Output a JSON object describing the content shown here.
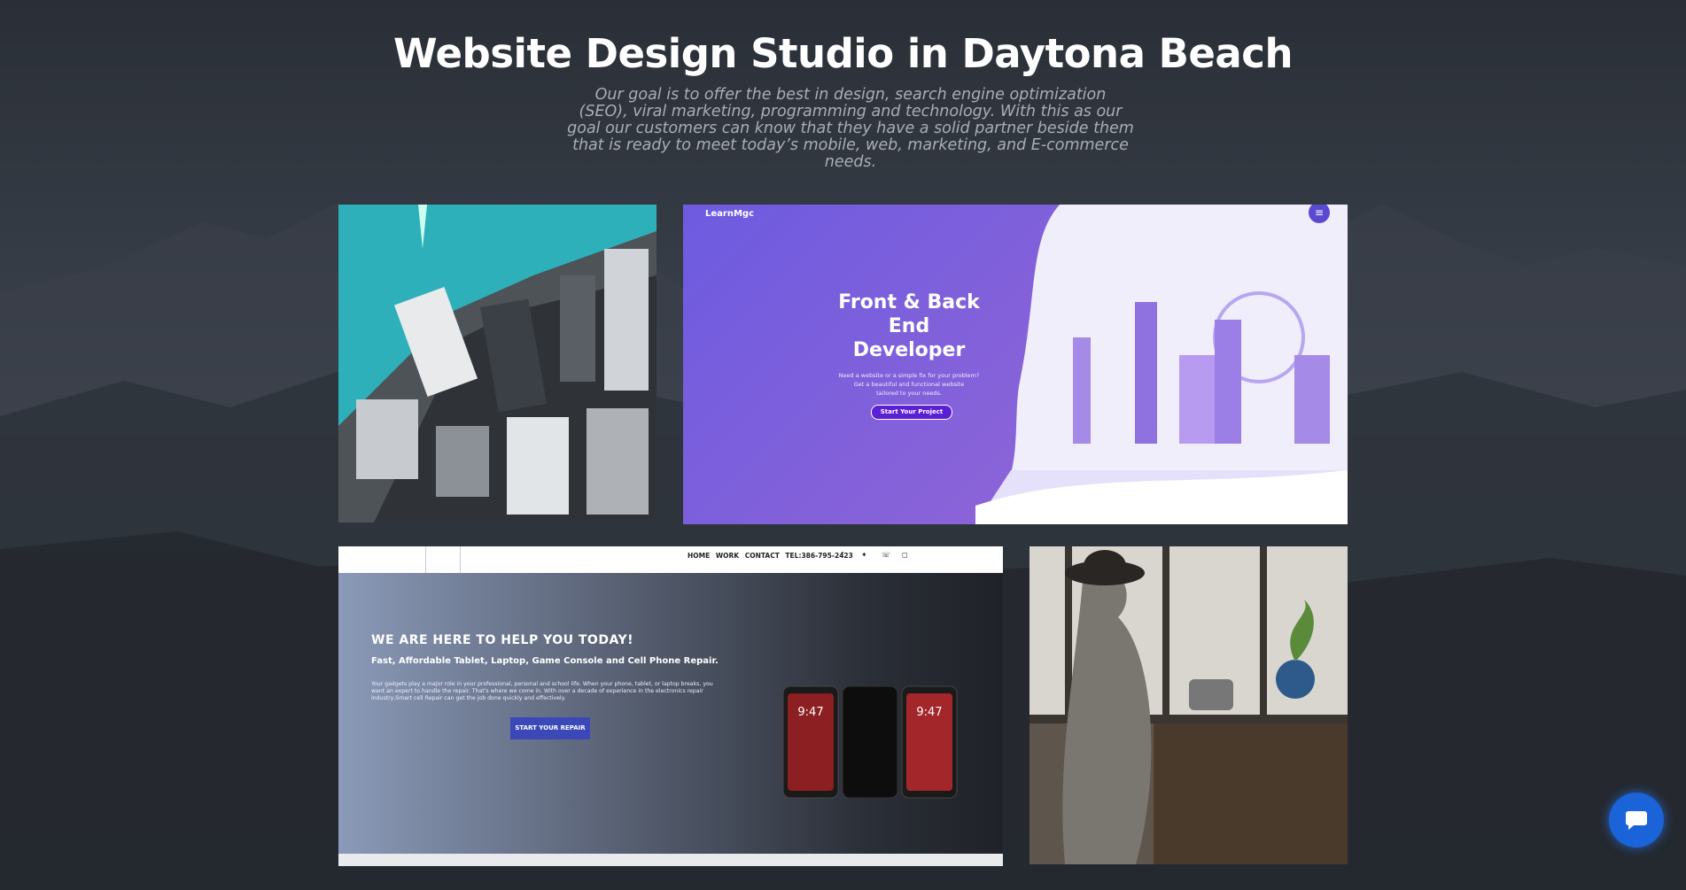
{
  "section": {
    "title": "Website Design Studio in Daytona Beach",
    "intro_lines": [
      "Our goal is to offer the best in design, search engine optimization",
      "(SEO), viral marketing, programming and technology. With this as our",
      "goal our customers can know that they have a solid partner beside them",
      "that is ready to meet today’s mobile, web, marketing, and E-commerce needs."
    ]
  },
  "portfolio": {
    "learnmagic": {
      "logo": "LearnMgc",
      "heading_lines": [
        "Front & Back",
        "End",
        "Developer"
      ],
      "subtext_lines": [
        "Need a website or a simple fix for your problem?",
        "Get a beautiful and functional website",
        "tailored to your needs."
      ],
      "button": "Start Your Project",
      "accent": "#5b1fd6"
    },
    "repair": {
      "nav": "HOME  WORK  CONTACT  TEL:386-795-2423",
      "heading": "WE ARE HERE TO HELP YOU TODAY!",
      "subheading": "Fast, Affordable Tablet, Laptop, Game Console and Cell Phone Repair.",
      "paragraph": "Your gadgets play a major role in your professional, personal and school life. When your phone, tablet, or laptop breaks, you want an expert to handle the repair. That's where we come in. With over a decade of experience in the electronics repair industry,Smart cell Repair can get the job done quickly and effectively.",
      "button": "START YOUR REPAIR",
      "phone_time": "9:47"
    }
  },
  "chat": {
    "icon": "chat-bubble-icon"
  }
}
